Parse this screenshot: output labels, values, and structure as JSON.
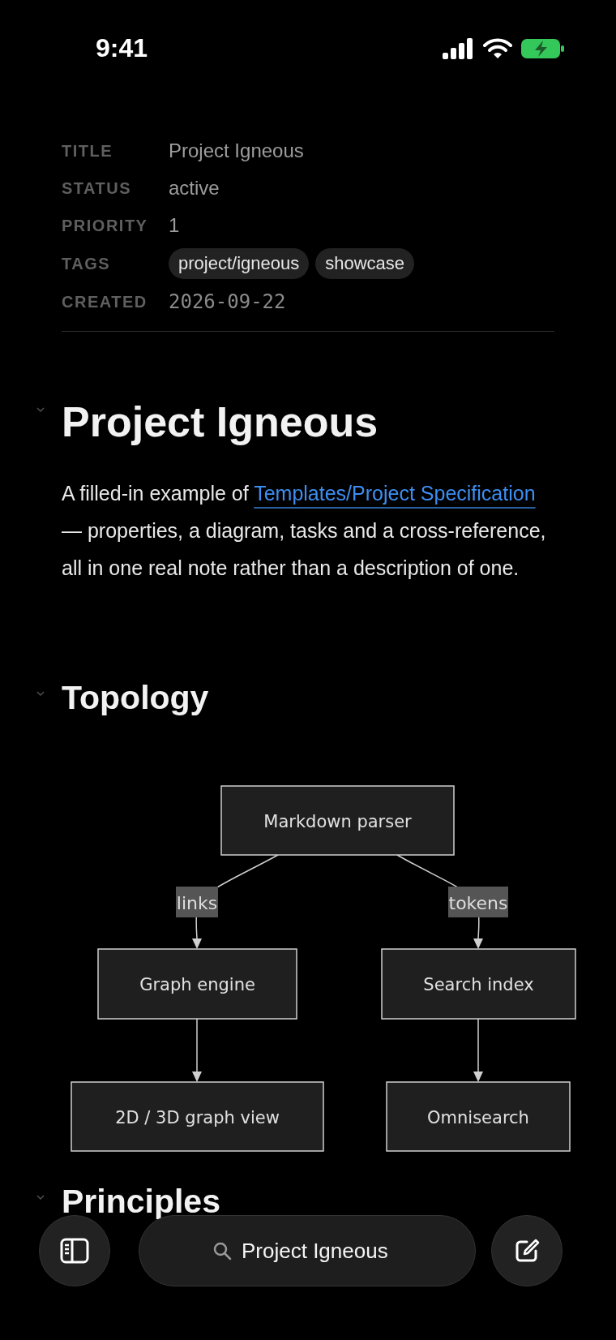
{
  "status_bar": {
    "time": "9:41"
  },
  "properties": [
    {
      "key": "TITLE",
      "kind": "text",
      "value": "Project Igneous"
    },
    {
      "key": "STATUS",
      "kind": "text",
      "value": "active"
    },
    {
      "key": "PRIORITY",
      "kind": "text",
      "value": "1"
    },
    {
      "key": "TAGS",
      "kind": "tags",
      "tags": [
        "project/igneous",
        "showcase"
      ]
    },
    {
      "key": "CREATED",
      "kind": "date",
      "value": "2026-09-22"
    }
  ],
  "heading": {
    "text": "Project Igneous",
    "expanded": true
  },
  "intro": {
    "before": "A filled-in example of ",
    "link": "Templates/Project Specification",
    "after": " — properties, a diagram, tasks and a cross-reference, all in one real note rather than a description of one."
  },
  "topology": {
    "heading": "Topology",
    "expanded": true,
    "nodes": [
      {
        "label": "Markdown parser"
      },
      {
        "label": "Graph engine"
      },
      {
        "label": "Search index"
      },
      {
        "label": "2D / 3D graph view"
      },
      {
        "label": "Omnisearch"
      }
    ],
    "edges": [
      {
        "kind": "labeled",
        "label": "links"
      },
      {
        "kind": "labeled",
        "label": "tokens"
      },
      {
        "kind": "plain"
      },
      {
        "kind": "plain"
      }
    ]
  },
  "next_heading": {
    "text": "Principles",
    "expanded": true
  },
  "bottom_bar": {
    "search": "Project Igneous"
  }
}
